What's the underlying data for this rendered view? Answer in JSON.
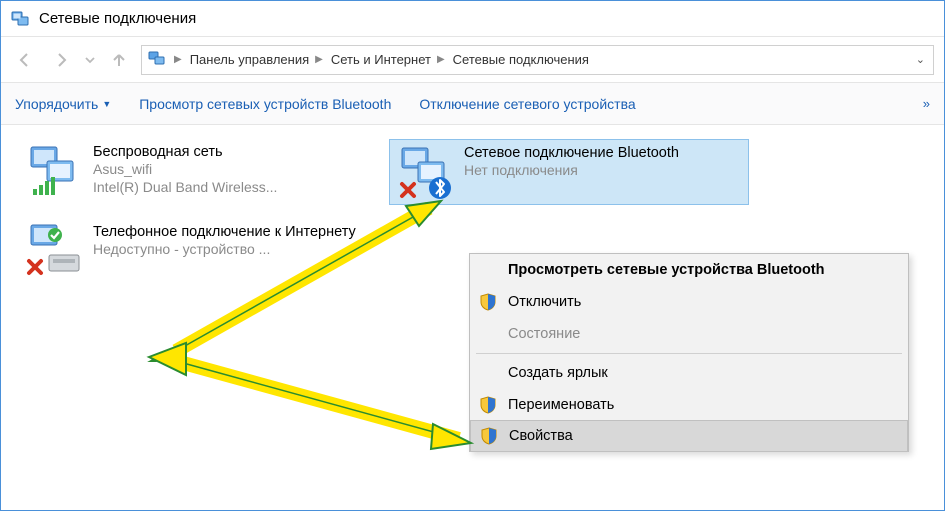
{
  "window": {
    "title": "Сетевые подключения"
  },
  "breadcrumbs": {
    "items": [
      "Панель управления",
      "Сеть и Интернет",
      "Сетевые подключения"
    ]
  },
  "toolbar": {
    "organize": "Упорядочить",
    "bluetooth_view": "Просмотр сетевых устройств Bluetooth",
    "disable": "Отключение сетевого устройства"
  },
  "connections": {
    "wifi": {
      "name": "Беспроводная сеть",
      "ssid": "Asus_wifi",
      "adapter": "Intel(R) Dual Band Wireless..."
    },
    "bt": {
      "name": "Сетевое подключение Bluetooth",
      "status": "Нет подключения"
    },
    "dial": {
      "name": "Телефонное подключение к Интернету",
      "status": "Недоступно - устройство ..."
    }
  },
  "context_menu": {
    "header": "Просмотреть сетевые устройства Bluetooth",
    "disable": "Отключить",
    "status": "Состояние",
    "shortcut": "Создать ярлык",
    "rename": "Переименовать",
    "properties": "Свойства"
  }
}
